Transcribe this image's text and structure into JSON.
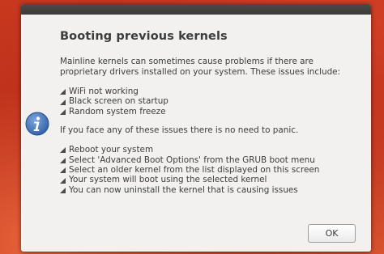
{
  "dialog": {
    "title": "Booting previous kernels",
    "intro": [
      "Mainline kernels can sometimes cause problems if there are",
      "proprietary drivers installed on your system. These issues include:"
    ],
    "issues": [
      "WiFi not working",
      "Black screen on startup",
      "Random system freeze"
    ],
    "panic_note": "If you face any of these issues there is no need to panic.",
    "steps": [
      "Reboot your system",
      "Select 'Advanced Boot Options' from the GRUB boot menu",
      "Select an older kernel from the list displayed on this screen",
      "Your system will boot using the selected kernel",
      "You can now uninstall the kernel that is causing issues"
    ],
    "ok_label": "OK",
    "icon": "info-icon",
    "bullet_icon": "bullet-arrow-icon"
  },
  "colors": {
    "dialog_bg": "#f2f1f0",
    "text": "#3c3c3c",
    "desktop_accent": "#c0331f",
    "info_icon": "#3d6fb7"
  }
}
